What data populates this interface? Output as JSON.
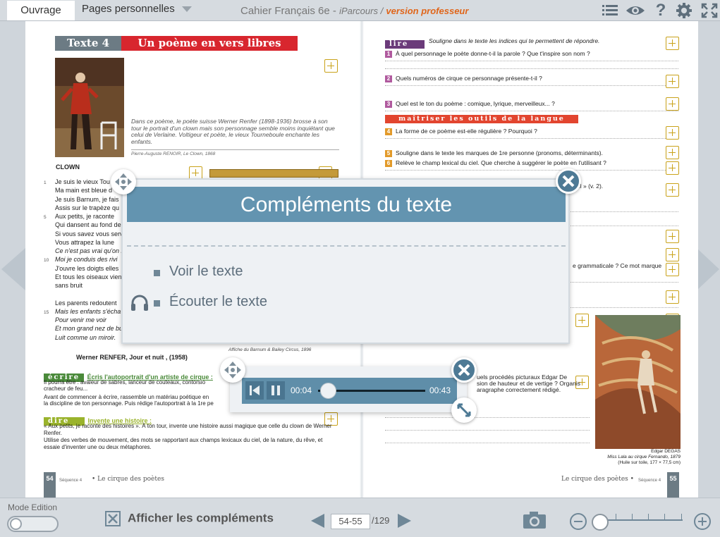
{
  "topbar": {
    "tab_ouvrage": "Ouvrage",
    "tab_pages": "Pages personnelles",
    "title_main": "Cahier Français 6e -",
    "title_sub": "iParcours /",
    "title_prof": "version professeur"
  },
  "left_page": {
    "banner_num": "Texte 4",
    "banner_title": "Un poème en vers libres",
    "intro": "Dans ce poème, le poète suisse Werner Renfer (1898-1936) brosse à son tour le portrait d'un clown mais son personnage semble moins inquiétant que celui de Verlaine. Voltigeur et poète, le vieux Tourneboule enchante les enfants.",
    "painting_caption": "Pierre-Auguste RENOIR, Le Clown, 1868",
    "poem_title": "CLOWN",
    "poem_lines": [
      {
        "n": "1",
        "t": "Je suis le vieux Tou"
      },
      {
        "n": "",
        "t": "Ma main est bleue d"
      },
      {
        "n": "",
        "t": "Je suis Barnum, je fais"
      },
      {
        "n": "",
        "t": "Assis sur le trapèze qu"
      },
      {
        "n": "5",
        "t": "Aux petits, je raconte"
      },
      {
        "n": "",
        "t": "Qui dansent au fond de"
      },
      {
        "n": "",
        "t": "Si vous savez vous serv"
      },
      {
        "n": "",
        "t": "Vous attrapez la lune"
      },
      {
        "n": "",
        "t": "Ce n'est pas vrai qu'on n"
      },
      {
        "n": "10",
        "t": "Moi je conduis des rivi"
      },
      {
        "n": "",
        "t": "J'ouvre les doigts elles"
      },
      {
        "n": "",
        "t": "Et tous les oiseaux vien"
      },
      {
        "n": "",
        "t": "sans bruit"
      },
      {
        "n": "",
        "t": ""
      },
      {
        "n": "",
        "t": "Les parents redoutent"
      },
      {
        "n": "15",
        "t": "Mais les enfants s'écha"
      },
      {
        "n": "",
        "t": "Pour venir me voir"
      },
      {
        "n": "",
        "t": "Et mon grand nez de bu"
      },
      {
        "n": "",
        "t": "Luit comme un miroir."
      }
    ],
    "poster_caption": "Affiche du Barnum & Bailey Circus, 1896",
    "author": "Werner RENFER, Jour et nuit , (1958)",
    "ecrire_tag": "écrire",
    "ecrire_title": "Écris l'autoportrait d'un artiste de cirque :",
    "ecrire_p1": "Il pourra être : avaleur de sabres, lanceur de couteaux, contorsio",
    "ecrire_p1b": "cracheur de feu...",
    "ecrire_p2": "Avant de commencer à écrire, rassemble un matériau poétique en",
    "ecrire_p2b": "la discipline de ton personnage. Puis rédige l'autoportrait à la 1re pe",
    "dire_tag": "dire",
    "dire_title": "Invente une histoire :",
    "dire_p1": "« Aux petits, je raconte des histoires ». À ton tour, invente une histoire aussi magique que celle du clown de Werner Renfer.",
    "dire_p2": "Utilise des verbes de mouvement, des mots se rapportant aux champs lexicaux du ciel, de la nature, du rêve, et essaie d'inventer une ou deux métaphores.",
    "footer_num": "54",
    "footer_seq": "Séquence 4",
    "footer_title": "Le cirque des poètes"
  },
  "right_page": {
    "lire_tag": "lire",
    "lire_instr": "Souligne dans le texte les indices qui te permettent de répondre.",
    "questions": [
      {
        "n": "1",
        "text": "À quel personnage le poète donne-t-il la parole ? Que t'inspire son nom ?"
      },
      {
        "n": "2",
        "text": "Quels numéros de cirque ce personnage présente-t-il ?"
      },
      {
        "n": "3",
        "text": "Quel est le ton du poème : comique, lyrique, merveilleux... ?"
      }
    ],
    "maitriser_tag": "maîtriser les outils de la langue",
    "questions2": [
      {
        "n": "4",
        "text": "La forme de ce poème est-elle régulière ? Pourquoi ?"
      },
      {
        "n": "5",
        "text": "Souligne dans le texte les marques de 1re personne (pronoms, déterminants)."
      },
      {
        "n": "6",
        "text": "Relève le champ lexical du ciel. Que cherche à suggérer le poète en l'utilisant ?"
      }
    ],
    "partial_q7": "el » (v. 2).",
    "partial_q8": "e grammaticale ? Ce mot marque",
    "partial_q9a": "uels procédés picturaux Edgar De",
    "partial_q9b": "sion de hauteur et de vertige ? Organis",
    "partial_q9c": "aragraphe correctement rédigé.",
    "painting_caption_author": "Edgar DEGAS",
    "painting_caption_title": "Miss Lala au cirque Fernando, 1879",
    "painting_caption_dim": "(Huile sur toile, 177 × 77,5 cm)",
    "footer_title": "Le cirque des poètes",
    "footer_seq": "Séquence 4",
    "footer_num": "55"
  },
  "panel": {
    "title": "Compléments du texte",
    "item1": "Voir le texte",
    "item2": "Écouter le texte"
  },
  "player": {
    "time_current": "00:04",
    "time_total": "00:43",
    "progress": 0.09
  },
  "bottombar": {
    "mode_label": "Mode Edition",
    "show_complements": "Afficher les compléments",
    "page_field": "54-55",
    "page_total": "/129"
  },
  "colors": {
    "panel_header": "#6394b0",
    "accent_orange": "#e0661b",
    "banner_red": "#d8262e",
    "ecrire_green": "#4a8a3a",
    "dire_green": "#9ab32c",
    "lire_purple": "#6b3b7a",
    "maitriser_red": "#e2452f"
  }
}
